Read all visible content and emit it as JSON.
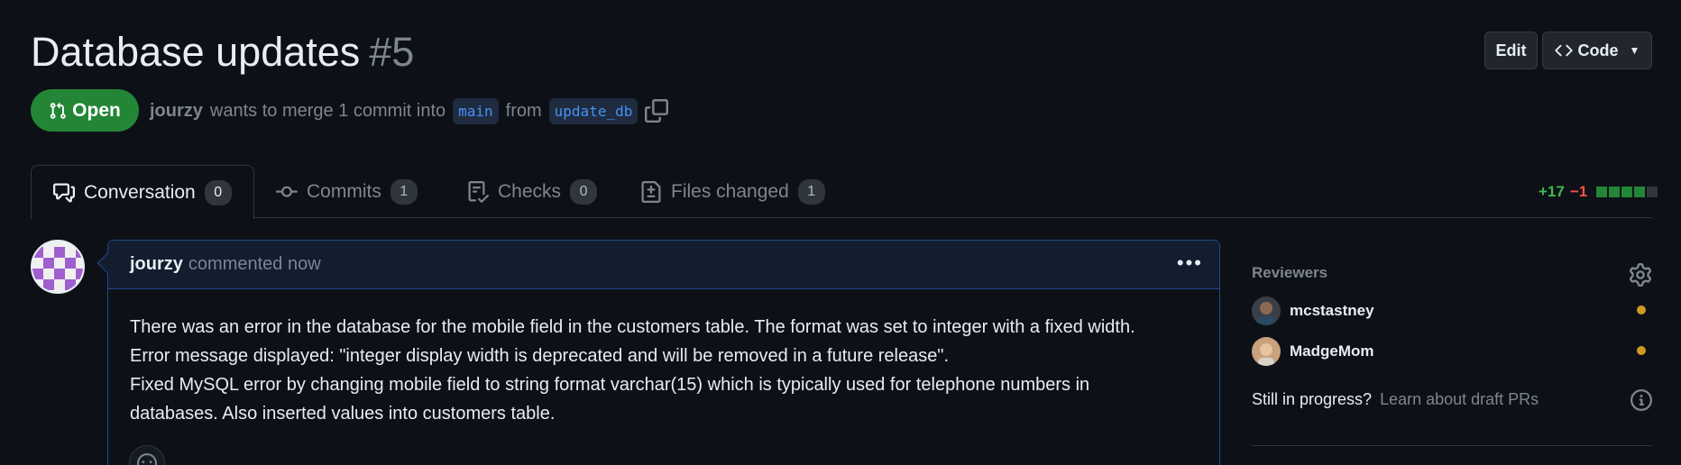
{
  "pr": {
    "title": "Database updates",
    "number": "#5",
    "state": "Open",
    "author": "jourzy",
    "merge_text": "wants to merge 1 commit into",
    "base_branch": "main",
    "from_text": "from",
    "head_branch": "update_db"
  },
  "header_actions": {
    "edit_label": "Edit",
    "code_label": "Code"
  },
  "tabs": [
    {
      "label": "Conversation",
      "count": "0",
      "icon": "conversation-icon",
      "active": true
    },
    {
      "label": "Commits",
      "count": "1",
      "icon": "commit-icon",
      "active": false
    },
    {
      "label": "Checks",
      "count": "0",
      "icon": "checks-icon",
      "active": false
    },
    {
      "label": "Files changed",
      "count": "1",
      "icon": "file-diff-icon",
      "active": false
    }
  ],
  "diffstat": {
    "additions": "+17",
    "deletions": "−1"
  },
  "comment": {
    "author": "jourzy",
    "timestamp": "commented now",
    "body": [
      "There was an error in the database for the mobile field in the customers table. The format was set to integer with a fixed width.",
      "Error message displayed: \"integer display width is deprecated and will be removed in a future release\".",
      "Fixed MySQL error by changing mobile field to string format varchar(15) which is typically used for telephone numbers in",
      "databases. Also inserted values into customers table."
    ]
  },
  "sidebar": {
    "reviewers_label": "Reviewers",
    "reviewers": [
      {
        "name": "mcstastney",
        "status": "pending"
      },
      {
        "name": "MadgeMom",
        "status": "pending"
      }
    ],
    "draft_prompt": "Still in progress?",
    "draft_link": "Learn about draft PRs"
  },
  "colors": {
    "background": "#0d1117",
    "open_green": "#238636",
    "accent_blue": "#4493f8",
    "pending_dot": "#d29922",
    "additions": "#3fb950",
    "deletions": "#f85149"
  }
}
